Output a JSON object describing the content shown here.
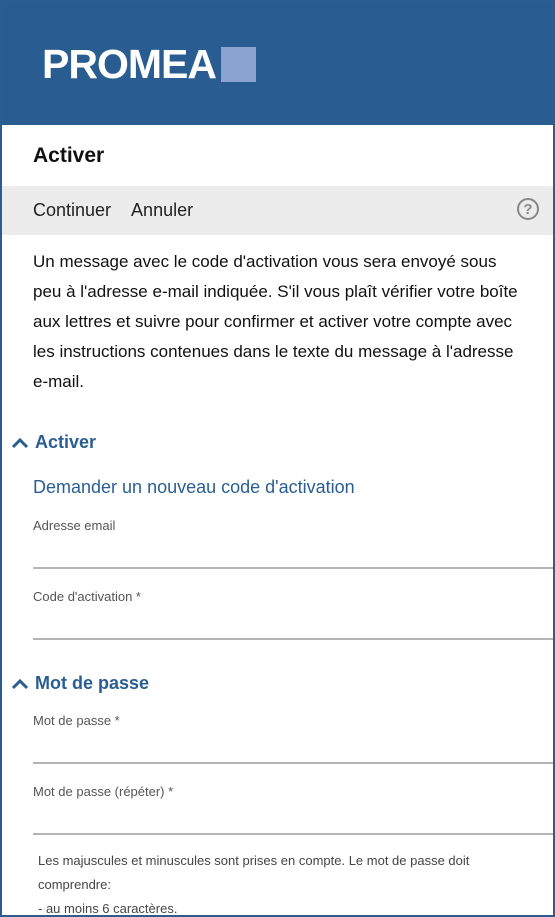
{
  "header": {
    "logo_text": "PROMEA"
  },
  "page": {
    "title": "Activer"
  },
  "toolbar": {
    "continue_label": "Continuer",
    "cancel_label": "Annuler",
    "help_icon": "?"
  },
  "message": "Un message avec le code d'activation vous sera envoyé sous peu à l'adresse e-mail indiquée. S'il vous plaît vérifier votre boîte aux lettres et suivre pour confirmer et activer votre compte avec les instructions contenues dans le texte du message à l'adresse e-mail.",
  "activate_section": {
    "heading": "Activer",
    "new_code_link": "Demander un nouveau code d'activation",
    "email_label": "Adresse email",
    "email_value": "",
    "code_label": "Code d'activation *",
    "code_value": ""
  },
  "password_section": {
    "heading": "Mot de passe",
    "password_label": "Mot de passe *",
    "password_value": "",
    "repeat_label": "Mot de passe (répéter) *",
    "repeat_value": "",
    "hint_line1": "Les majuscules et minuscules sont prises en compte. Le mot de passe doit comprendre:",
    "hint_line2": "- au moins 6 caractères."
  },
  "colors": {
    "brand": "#295d92",
    "accent": "#8aa3d1",
    "toolbar_bg": "#ececec"
  }
}
